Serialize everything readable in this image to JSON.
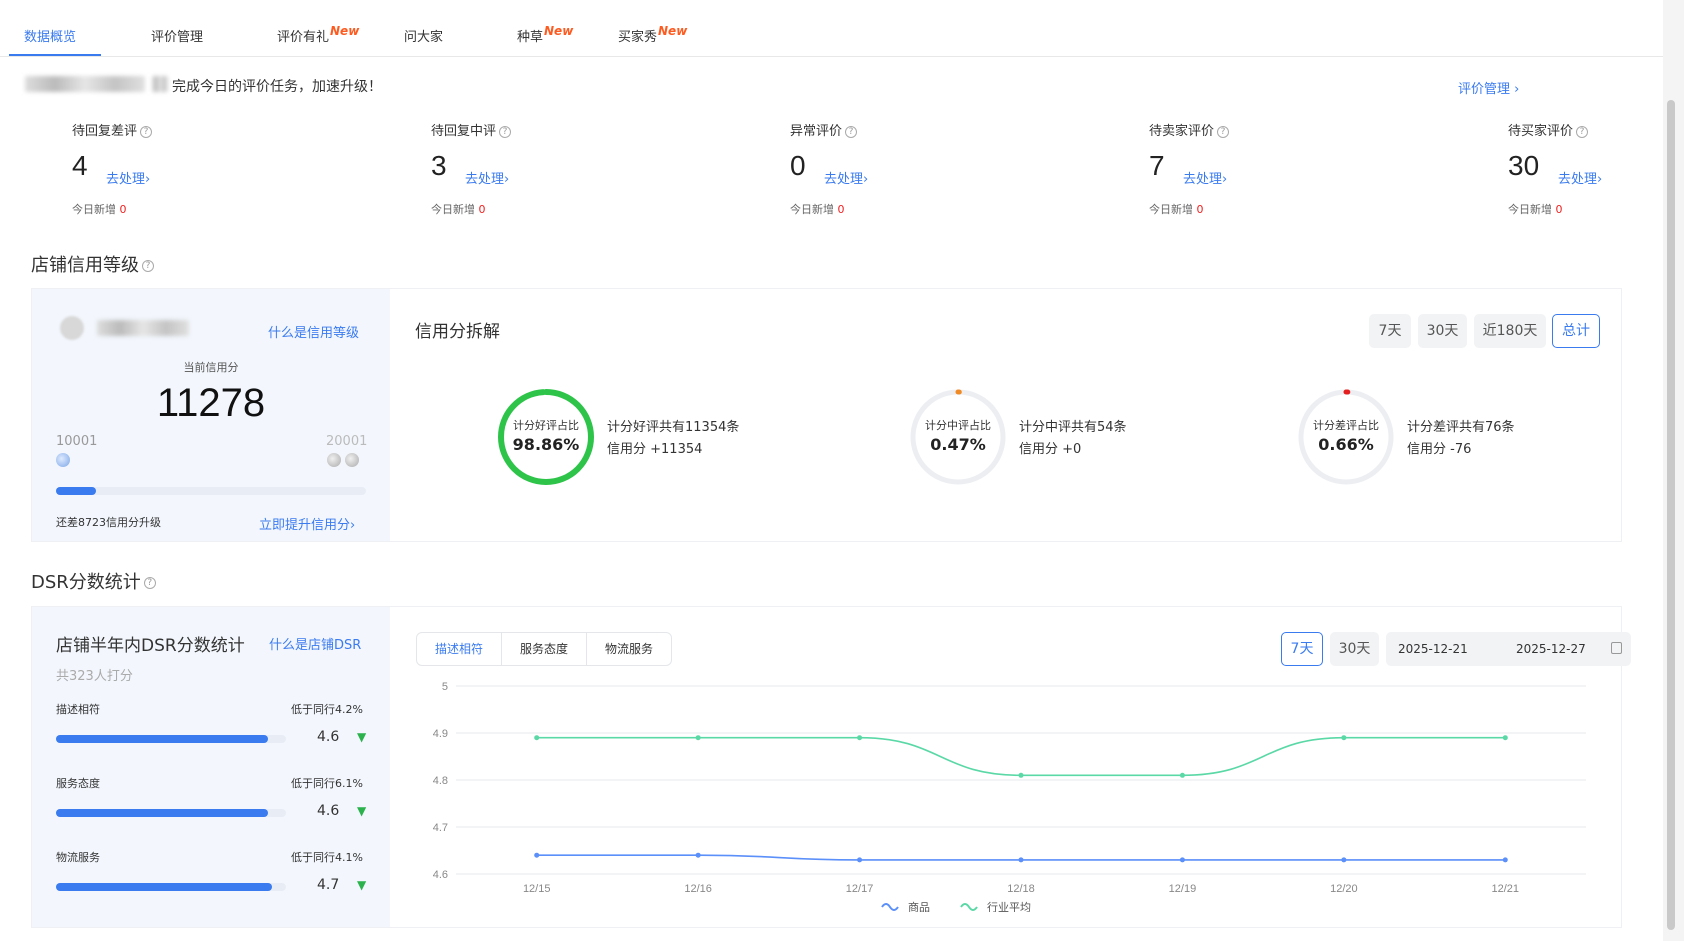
{
  "tabs": [
    {
      "label": "数据概览",
      "new": ""
    },
    {
      "label": "评价管理",
      "new": ""
    },
    {
      "label": "评价有礼",
      "new": "New"
    },
    {
      "label": "问大家",
      "new": ""
    },
    {
      "label": "种草",
      "new": "New"
    },
    {
      "label": "买家秀",
      "new": "New"
    }
  ],
  "notice": {
    "text": "完成今日的评价任务，加速升级！",
    "manage_link": "评价管理 ›"
  },
  "stats": [
    {
      "label": "待回复差评",
      "value": "4",
      "action": "去处理›",
      "today_label": "今日新增",
      "today_value": "0"
    },
    {
      "label": "待回复中评",
      "value": "3",
      "action": "去处理›",
      "today_label": "今日新增",
      "today_value": "0"
    },
    {
      "label": "异常评价",
      "value": "0",
      "action": "去处理›",
      "today_label": "今日新增",
      "today_value": "0"
    },
    {
      "label": "待卖家评价",
      "value": "7",
      "action": "去处理›",
      "today_label": "今日新增",
      "today_value": "0"
    },
    {
      "label": "待买家评价",
      "value": "30",
      "action": "去处理›",
      "today_label": "今日新增",
      "today_value": "0"
    }
  ],
  "credit": {
    "section_title": "店铺信用等级",
    "what_link": "什么是信用等级",
    "current_label": "当前信用分",
    "current_value": "11278",
    "range_min": "10001",
    "range_max": "20001",
    "progress_fraction": 0.13,
    "gap_text": "还差8723信用分升级",
    "improve_link": "立即提升信用分›",
    "breakdown_title": "信用分拆解",
    "periods": [
      "7天",
      "30天",
      "近180天",
      "总计"
    ],
    "active_period": "总计",
    "items": [
      {
        "ring_label": "计分好评占比",
        "percent": "98.86%",
        "fraction": 0.9886,
        "color": "#2ec44a",
        "line1": "计分好评共有11354条",
        "line2": "信用分 +11354"
      },
      {
        "ring_label": "计分中评占比",
        "percent": "0.47%",
        "fraction": 0.0047,
        "color": "#f08a24",
        "line1": "计分中评共有54条",
        "line2": "信用分 +0"
      },
      {
        "ring_label": "计分差评占比",
        "percent": "0.66%",
        "fraction": 0.0066,
        "color": "#e41e1e",
        "line1": "计分差评共有76条",
        "line2": "信用分 -76"
      }
    ]
  },
  "dsr": {
    "section_title": "DSR分数统计",
    "card_title": "店铺半年内DSR分数统计",
    "what_link": "什么是店铺DSR",
    "raters": "共323人打分",
    "items": [
      {
        "label": "描述相符",
        "compare": "低于同行4.2%",
        "score": "4.6",
        "fraction": 0.92
      },
      {
        "label": "服务态度",
        "compare": "低于同行6.1%",
        "score": "4.6",
        "fraction": 0.92
      },
      {
        "label": "物流服务",
        "compare": "低于同行4.1%",
        "score": "4.7",
        "fraction": 0.94
      }
    ],
    "chart_tabs": [
      "描述相符",
      "服务态度",
      "物流服务"
    ],
    "active_chart_tab": "描述相符",
    "range_buttons": [
      "7天",
      "30天"
    ],
    "active_range": "7天",
    "date_start": "2025-12-21",
    "date_end": "2025-12-27"
  },
  "chart_data": {
    "type": "line",
    "x": [
      "12/15",
      "12/16",
      "12/17",
      "12/18",
      "12/19",
      "12/20",
      "12/21"
    ],
    "yticks": [
      "5",
      "4.9",
      "4.8",
      "4.7",
      "4.6"
    ],
    "ylim": [
      4.6,
      5.0
    ],
    "grid": true,
    "legend_position": "bottom",
    "series": [
      {
        "name": "商品",
        "color": "#5b8ff9",
        "values": [
          4.64,
          4.64,
          4.63,
          4.63,
          4.63,
          4.63,
          4.63
        ]
      },
      {
        "name": "行业平均",
        "color": "#5ad8a6",
        "values": [
          4.89,
          4.89,
          4.89,
          4.81,
          4.81,
          4.89,
          4.89
        ]
      }
    ]
  }
}
